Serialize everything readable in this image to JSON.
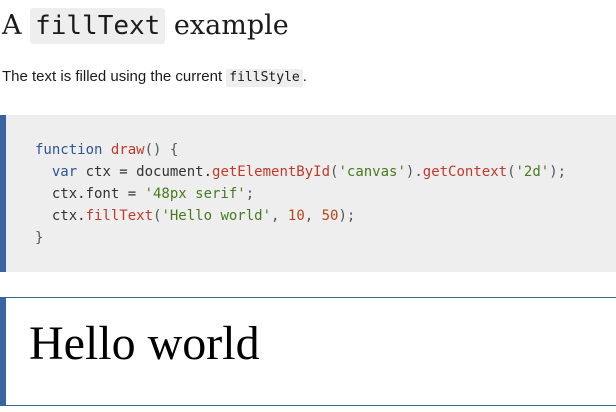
{
  "heading": {
    "prefix": "A ",
    "code": "fillText",
    "suffix": " example"
  },
  "description": {
    "text_before": "The text is filled using the current ",
    "code": "fillStyle",
    "text_after": "."
  },
  "code_block": {
    "line1_kw": "function",
    "line1_fn": "draw",
    "line1_rest": "() {",
    "line2_kw": "var",
    "line2_a": " ctx = document.",
    "line2_fn1": "getElementById",
    "line2_p1": "(",
    "line2_s1": "'canvas'",
    "line2_p2": ").",
    "line2_fn2": "getContext",
    "line2_p3": "(",
    "line2_s2": "'2d'",
    "line2_p4": ");",
    "line3_a": "ctx.font = ",
    "line3_s": "'48px serif'",
    "line3_p": ";",
    "line4_a": "ctx.",
    "line4_fn": "fillText",
    "line4_p1": "(",
    "line4_s": "'Hello world'",
    "line4_c1": ", ",
    "line4_n1": "10",
    "line4_c2": ", ",
    "line4_n2": "50",
    "line4_p2": ");",
    "line5": "}"
  },
  "output": {
    "canvas_text": "Hello world"
  }
}
